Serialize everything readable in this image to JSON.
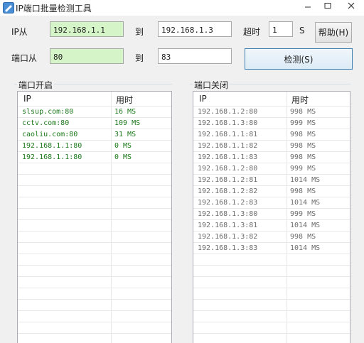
{
  "window": {
    "title": "IP端口批量检测工具",
    "controls": {
      "minimize": "—",
      "maximize": "□",
      "close": "✕"
    }
  },
  "form": {
    "ip_from_label": "IP从",
    "ip_from_value": "192.168.1.1",
    "ip_to_label": "到",
    "ip_to_value": "192.168.1.3",
    "timeout_label": "超时",
    "timeout_value": "1",
    "timeout_unit": "S",
    "help_button": "帮助(H)",
    "port_from_label": "端口从",
    "port_from_value": "80",
    "port_to_label": "到",
    "port_to_value": "83",
    "detect_button": "检测(S)"
  },
  "open_ports": {
    "title": "端口开启",
    "columns": [
      "IP",
      "用时"
    ],
    "rows": [
      {
        "ip": "slsup.com:80",
        "time": "16 MS"
      },
      {
        "ip": "cctv.com:80",
        "time": "109 MS"
      },
      {
        "ip": "caoliu.com:80",
        "time": "31 MS"
      },
      {
        "ip": "192.168.1.1:80",
        "time": "0 MS"
      },
      {
        "ip": "192.168.1.1:80",
        "time": "0 MS"
      }
    ]
  },
  "closed_ports": {
    "title": "端口关闭",
    "columns": [
      "IP",
      "用时"
    ],
    "rows": [
      {
        "ip": "192.168.1.2:80",
        "time": "998 MS"
      },
      {
        "ip": "192.168.1.3:80",
        "time": "999 MS"
      },
      {
        "ip": "192.168.1.1:81",
        "time": "998 MS"
      },
      {
        "ip": "192.168.1.1:82",
        "time": "998 MS"
      },
      {
        "ip": "192.168.1.1:83",
        "time": "998 MS"
      },
      {
        "ip": "192.168.1.2:80",
        "time": "999 MS"
      },
      {
        "ip": "192.168.1.2:81",
        "time": "1014 MS"
      },
      {
        "ip": "192.168.1.2:82",
        "time": "998 MS"
      },
      {
        "ip": "192.168.1.2:83",
        "time": "1014 MS"
      },
      {
        "ip": "192.168.1.3:80",
        "time": "999 MS"
      },
      {
        "ip": "192.168.1.3:81",
        "time": "1014 MS"
      },
      {
        "ip": "192.168.1.3:82",
        "time": "998 MS"
      },
      {
        "ip": "192.168.1.3:83",
        "time": "1014 MS"
      }
    ]
  },
  "colors": {
    "open_text": "#1e7a1e",
    "closed_text": "#6d6d6d",
    "input_highlight": "#d5f5c8"
  }
}
